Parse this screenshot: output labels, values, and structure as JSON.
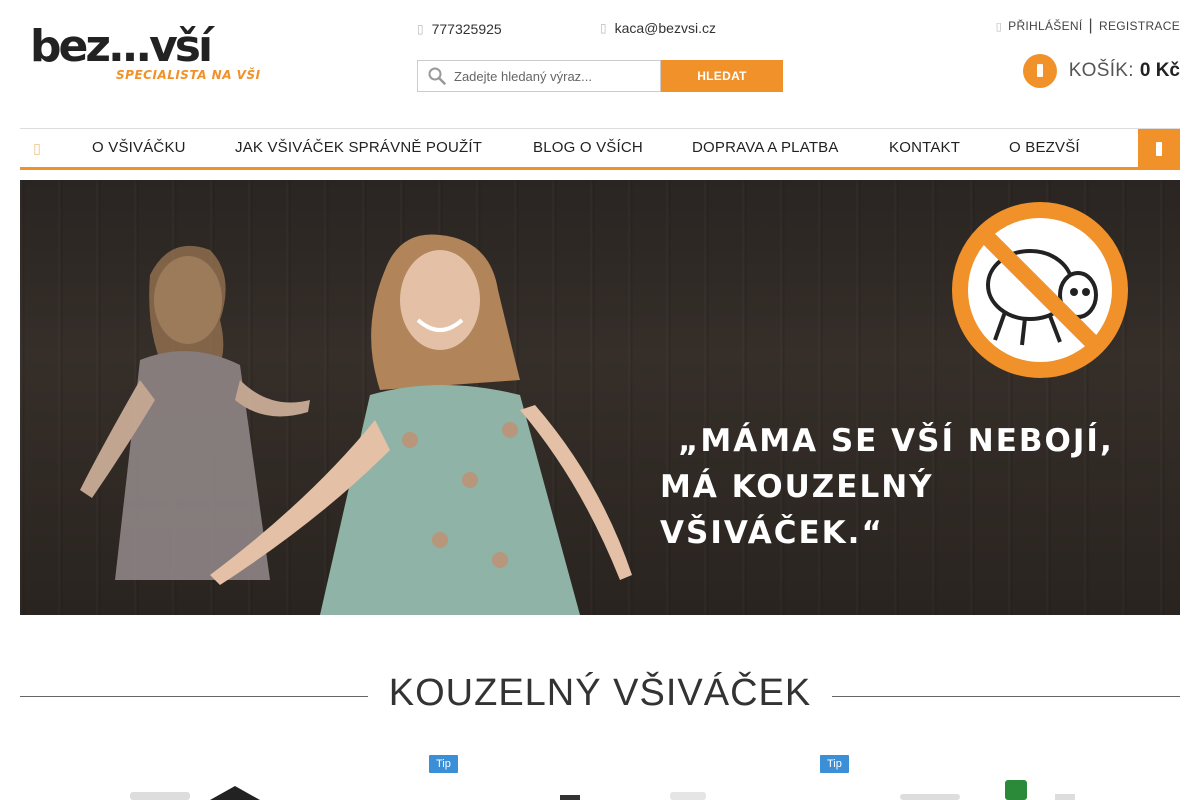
{
  "header": {
    "logo_text": "bez...vší",
    "logo_tagline": "SPECIALISTA NA VŠI",
    "phone": "777325925",
    "email": "kaca@bezvsi.cz",
    "login": "PŘIHLÁŠENÍ",
    "separator": "|",
    "register": "REGISTRACE",
    "search_placeholder": "Zadejte hledaný výraz...",
    "search_button": "HLEDAT",
    "cart_label": "KOŠÍK:",
    "cart_total": "0 Kč"
  },
  "nav": {
    "items": [
      {
        "label": "O VŠIVÁČKU"
      },
      {
        "label": "JAK VŠIVÁČEK SPRÁVNĚ POUŽÍT"
      },
      {
        "label": "BLOG O VŠÍCH"
      },
      {
        "label": "DOPRAVA A PLATBA"
      },
      {
        "label": "KONTAKT"
      },
      {
        "label": "O BEZVŠÍ"
      }
    ]
  },
  "hero": {
    "quote_line1": "„MÁMA SE VŠÍ NEBOJÍ,",
    "quote_line2": "MÁ KOUZELNÝ VŠIVÁČEK.“"
  },
  "section": {
    "title": "KOUZELNÝ VŠIVÁČEK"
  },
  "products": {
    "badges": [
      "Tip",
      "Tip"
    ]
  },
  "colors": {
    "accent": "#f0912a",
    "tip_badge": "#3b8fd6"
  },
  "icons": [
    "phone-icon",
    "email-icon",
    "user-icon",
    "search-icon",
    "cart-icon",
    "home-icon",
    "menu-icon",
    "no-lice-icon"
  ]
}
